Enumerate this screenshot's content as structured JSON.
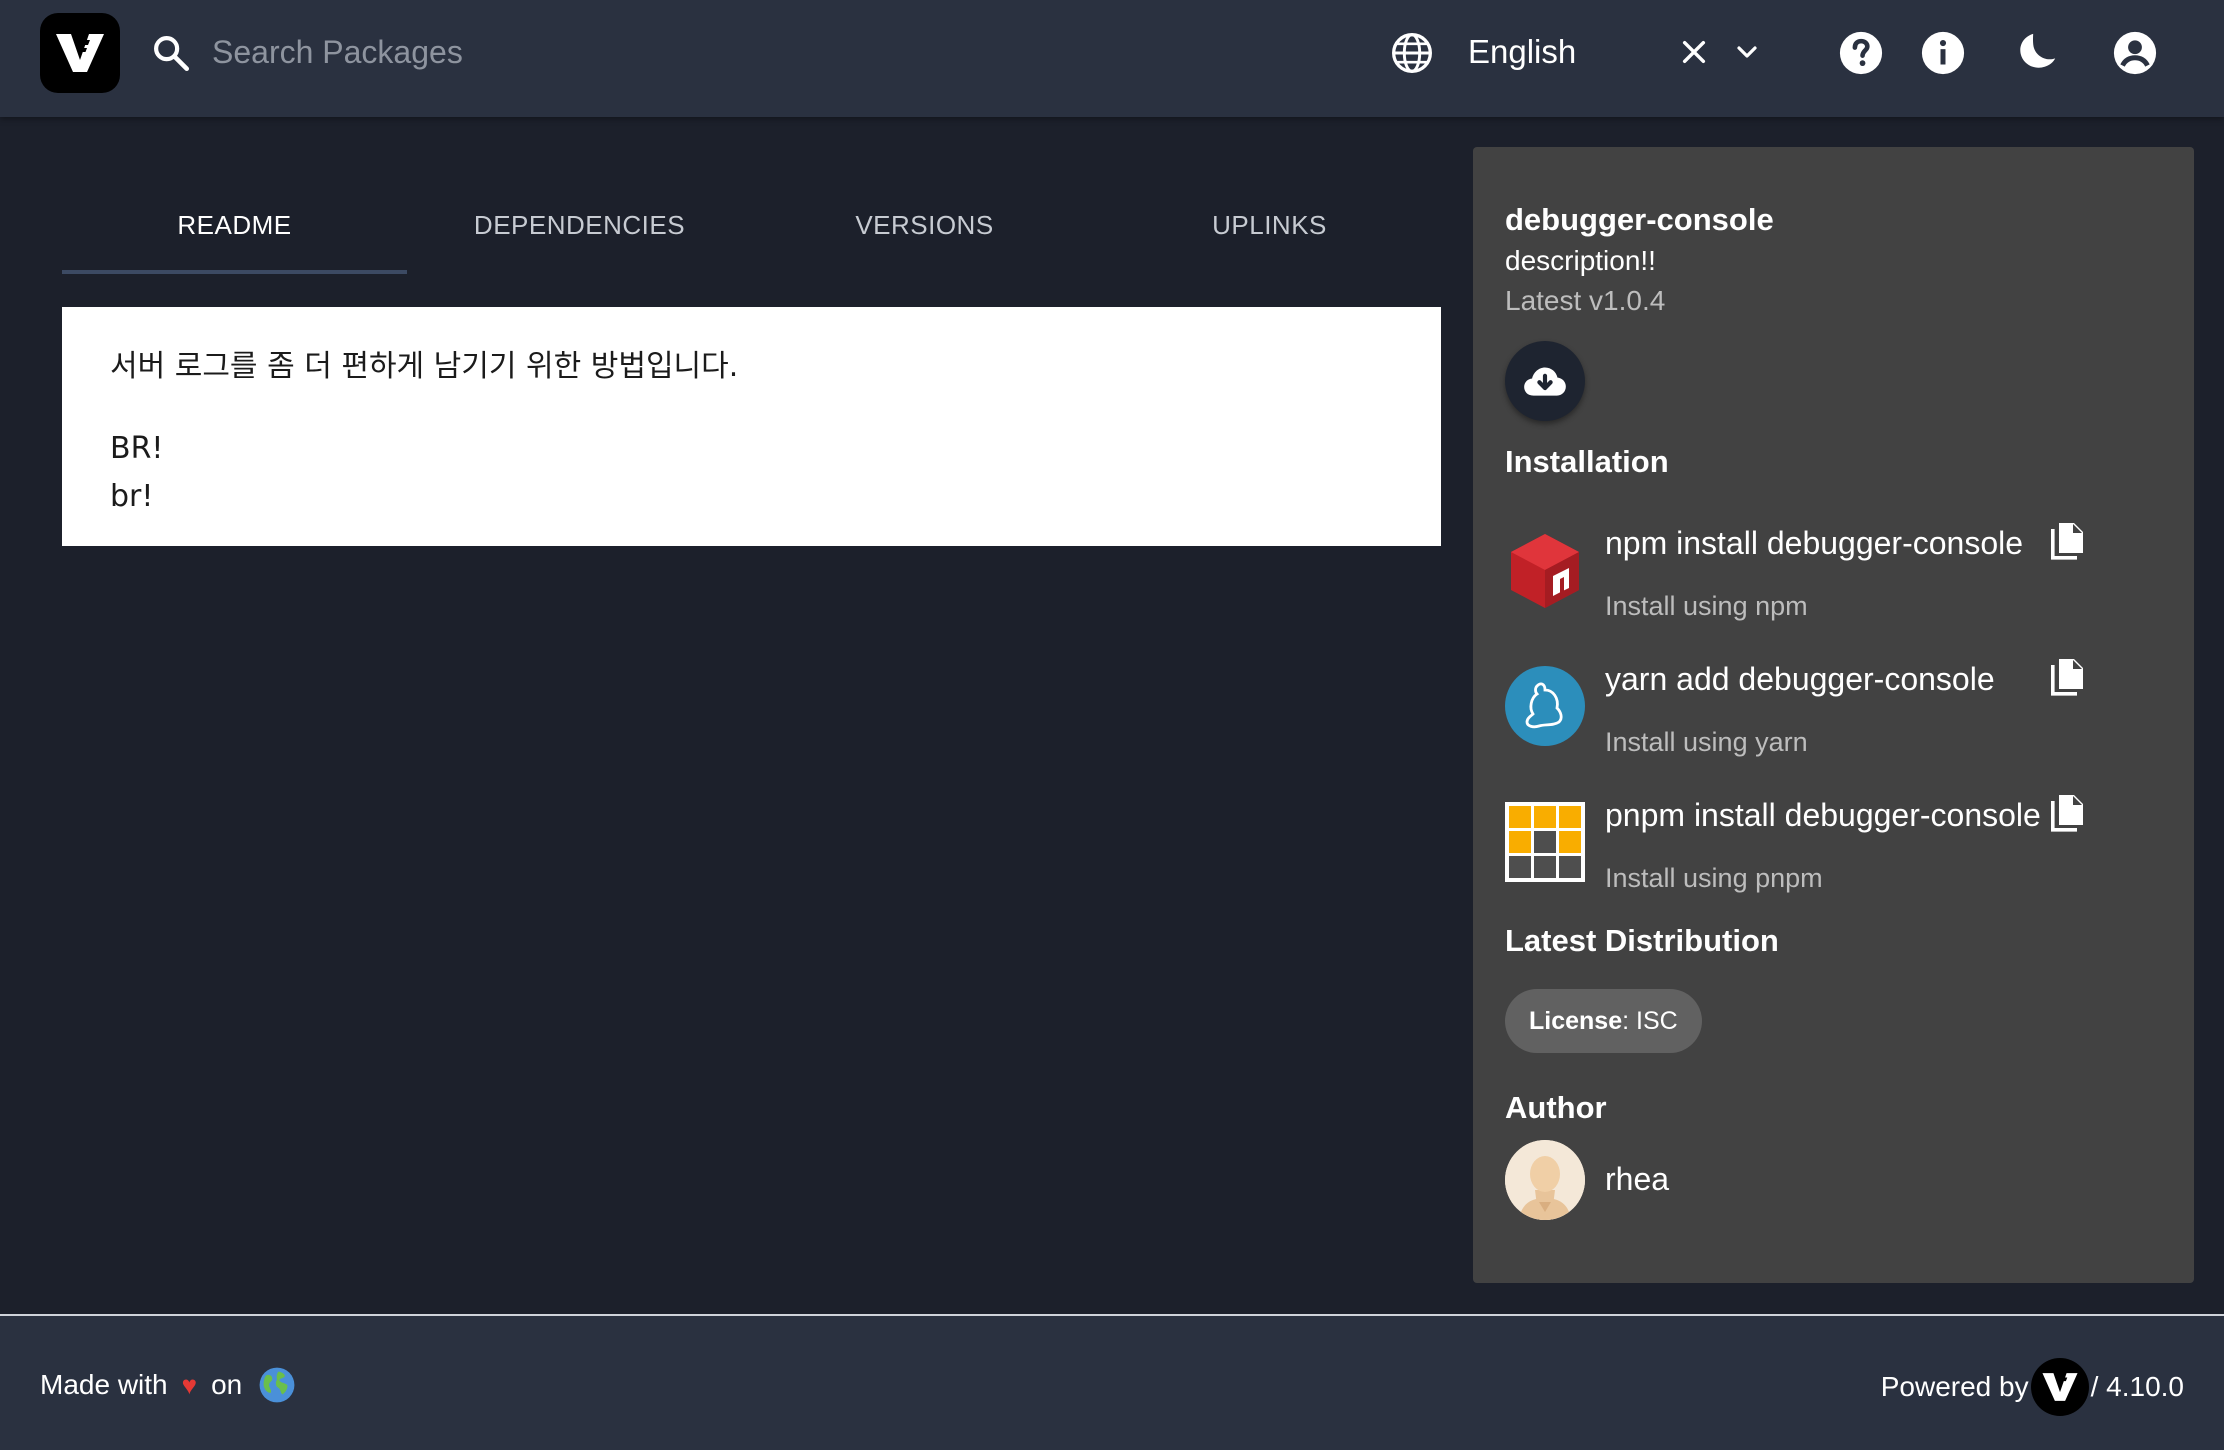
{
  "header": {
    "search": {
      "placeholder": "Search Packages",
      "value": ""
    },
    "language": {
      "selected": "English"
    },
    "icons": [
      "search-icon",
      "globe-icon",
      "clear-icon",
      "chevron-down-icon",
      "help-icon",
      "info-icon",
      "dark-mode-icon",
      "account-icon"
    ]
  },
  "tabs": [
    {
      "label": "README",
      "active": true
    },
    {
      "label": "DEPENDENCIES",
      "active": false
    },
    {
      "label": "VERSIONS",
      "active": false
    },
    {
      "label": "UPLINKS",
      "active": false
    }
  ],
  "readme": {
    "line1": "서버 로그를 좀 더 편하게 남기기 위한 방법입니다.",
    "line2": "BR!",
    "line3": "br!"
  },
  "package": {
    "name": "debugger-console",
    "description": "description!!",
    "latest": "Latest v1.0.4"
  },
  "installation": {
    "title": "Installation",
    "items": [
      {
        "command": "npm install debugger-console",
        "subtitle": "Install using npm",
        "icon": "npm-icon"
      },
      {
        "command": "yarn add debugger-console",
        "subtitle": "Install using yarn",
        "icon": "yarn-icon"
      },
      {
        "command": "pnpm install debugger-console",
        "subtitle": "Install using pnpm",
        "icon": "pnpm-icon"
      }
    ]
  },
  "distribution": {
    "title": "Latest Distribution",
    "license_label": "License",
    "license_value": ": ISC"
  },
  "author": {
    "title": "Author",
    "name": "rhea"
  },
  "footer": {
    "made_with": "Made with",
    "heart": "♥",
    "on": "on",
    "powered_by": "Powered by",
    "version": "/ 4.10.0"
  },
  "colors": {
    "header_bg": "#2a3140",
    "page_bg": "#1c202b",
    "panel_bg": "#424242",
    "heart": "#e53935"
  }
}
